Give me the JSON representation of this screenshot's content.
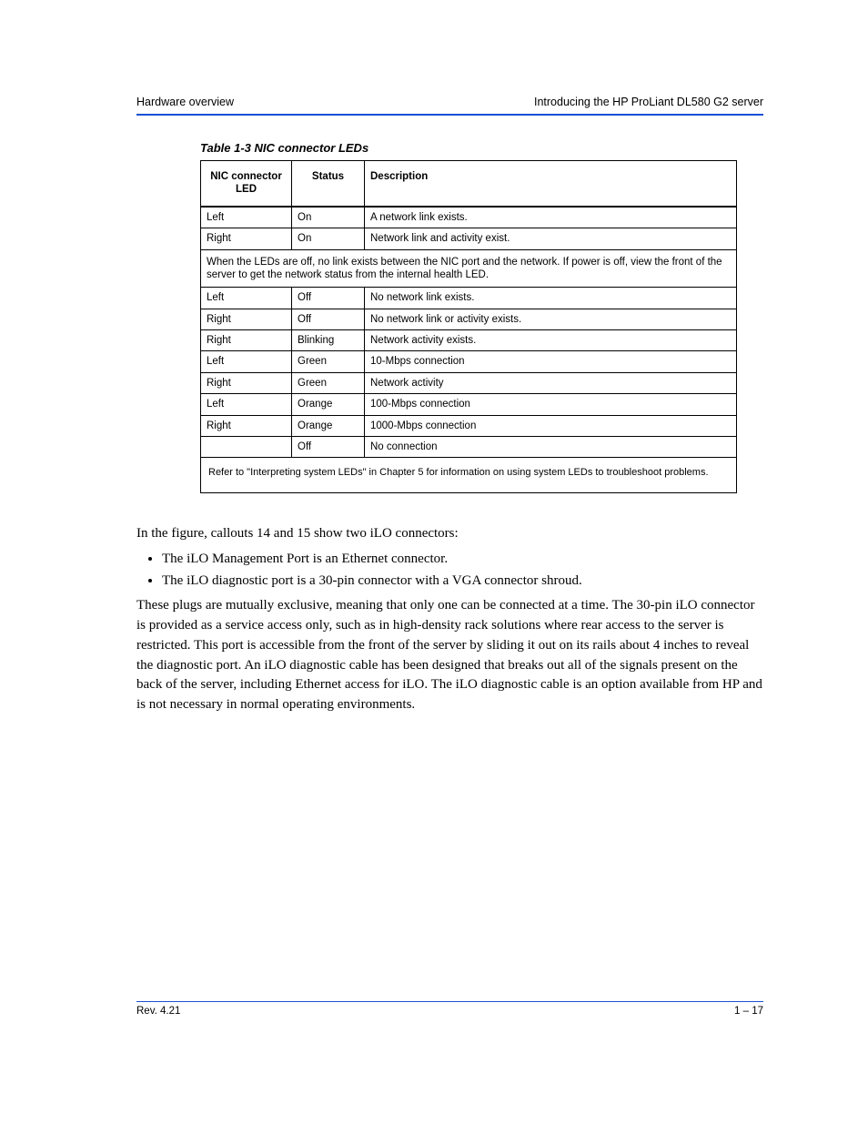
{
  "runningHead": {
    "left": "Hardware overview",
    "right": "Introducing the HP ProLiant DL580 G2 server"
  },
  "table": {
    "caption": "Table 1-3 NIC connector LEDs",
    "headers": [
      "NIC connector LED",
      "Status",
      "Description"
    ],
    "rows": [
      {
        "type": "data",
        "cells": [
          "Left",
          "On",
          "A network link exists."
        ]
      },
      {
        "type": "data",
        "cells": [
          "Right",
          "On",
          "Network link and activity exist."
        ]
      },
      {
        "type": "section",
        "text": "When the LEDs are off, no link exists between the NIC port and the network. If power is off, view the front of the server to get the network status from the internal health LED."
      },
      {
        "type": "data",
        "cells": [
          "Left",
          "Off",
          "No network link exists."
        ]
      },
      {
        "type": "data",
        "cells": [
          "Right",
          "Off",
          "No network link or activity exists."
        ]
      },
      {
        "type": "data",
        "cells": [
          "Right",
          "Blinking",
          "Network activity exists."
        ]
      },
      {
        "type": "data",
        "cells": [
          "Left",
          "Green",
          "10-Mbps connection"
        ]
      },
      {
        "type": "data",
        "cells": [
          "Right",
          "Green",
          "Network activity"
        ]
      },
      {
        "type": "data",
        "cells": [
          "Left",
          "Orange",
          "100-Mbps connection"
        ]
      },
      {
        "type": "data",
        "cells": [
          "Right",
          "Orange",
          "1000-Mbps connection"
        ]
      },
      {
        "type": "data",
        "cells": [
          "",
          "Off",
          "No connection"
        ]
      },
      {
        "type": "footnote",
        "text": "Refer to \"Interpreting system LEDs\" in Chapter 5 for information on using system LEDs to troubleshoot problems."
      }
    ]
  },
  "body": {
    "p1": "In the figure, callouts 14 and 15 show two iLO connectors:",
    "li1": "The iLO Management Port is an Ethernet connector.",
    "li2": "The iLO diagnostic port is a 30-pin connector with a VGA connector shroud.",
    "p2": "These plugs are mutually exclusive, meaning that only one can be connected at a time. The 30-pin iLO connector is provided as a service access only, such as in high-density rack solutions where rear access to the server is restricted. This port is accessible from the front of the server by sliding it out on its rails about 4 inches to reveal the diagnostic port. An iLO diagnostic cable has been designed that breaks out all of the signals present on the back of the server, including Ethernet access for iLO. The iLO diagnostic cable is an option available from HP and is not necessary in normal operating environments."
  },
  "footer": {
    "left": "Rev. 4.21",
    "right": "1 – 17"
  }
}
